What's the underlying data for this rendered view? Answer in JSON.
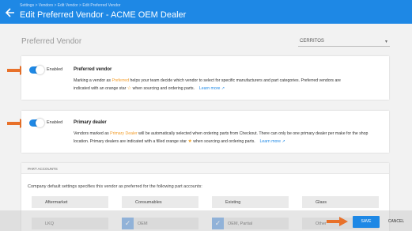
{
  "header": {
    "breadcrumb": "Settings > Vendors > Edit Vendor > Edit Preferred Vendor",
    "title": "Edit Preferred Vendor - ACME OEM Dealer"
  },
  "section_label": "Preferred Vendor",
  "location_select": {
    "value": "CERRITOS"
  },
  "preferred_vendor": {
    "toggle_label": "Enabled",
    "enabled": true,
    "title": "Preferred vendor",
    "desc_1": "Marking a vendor as ",
    "desc_hl": "Preferred",
    "desc_2": " helps your team decide which vendor to select for specific manufacturers and part categories. Preferred vendors are",
    "desc_3": "indicated with an orange star ",
    "desc_4": " when sourcing and ordering parts.",
    "learn_more": "Learn more"
  },
  "primary_dealer": {
    "toggle_label": "Enabled",
    "enabled": true,
    "title": "Primary dealer",
    "desc_1": "Vendors marked as ",
    "desc_hl": "Primary Dealer",
    "desc_2": " will be automatically selected when ordering parts from Checkout. There can only be one primary dealer per make for the shop",
    "desc_3": "location. Primary dealers are indicated with a filled orange star ",
    "desc_4": " when sourcing and ordering parts.",
    "learn_more": "Learn more"
  },
  "part_accounts": {
    "title": "PART ACCOUNTS",
    "description": "Company default settings specifies this vendor as preferred for the following part accounts:",
    "accounts": [
      {
        "label": "Aftermarket",
        "checked": false
      },
      {
        "label": "Consumables",
        "checked": false
      },
      {
        "label": "Existing",
        "checked": false
      },
      {
        "label": "Glass",
        "checked": false
      },
      {
        "label": "LKQ",
        "checked": false
      },
      {
        "label": "OEM",
        "checked": true
      },
      {
        "label": "OEM, Partial",
        "checked": true
      },
      {
        "label": "Other",
        "checked": false
      }
    ]
  },
  "actions": {
    "save": "SAVE",
    "cancel": "CANCEL"
  },
  "colors": {
    "primary": "#1e88e5",
    "accent_orange": "#f29d2b",
    "annotation_arrow": "#e8712a"
  }
}
